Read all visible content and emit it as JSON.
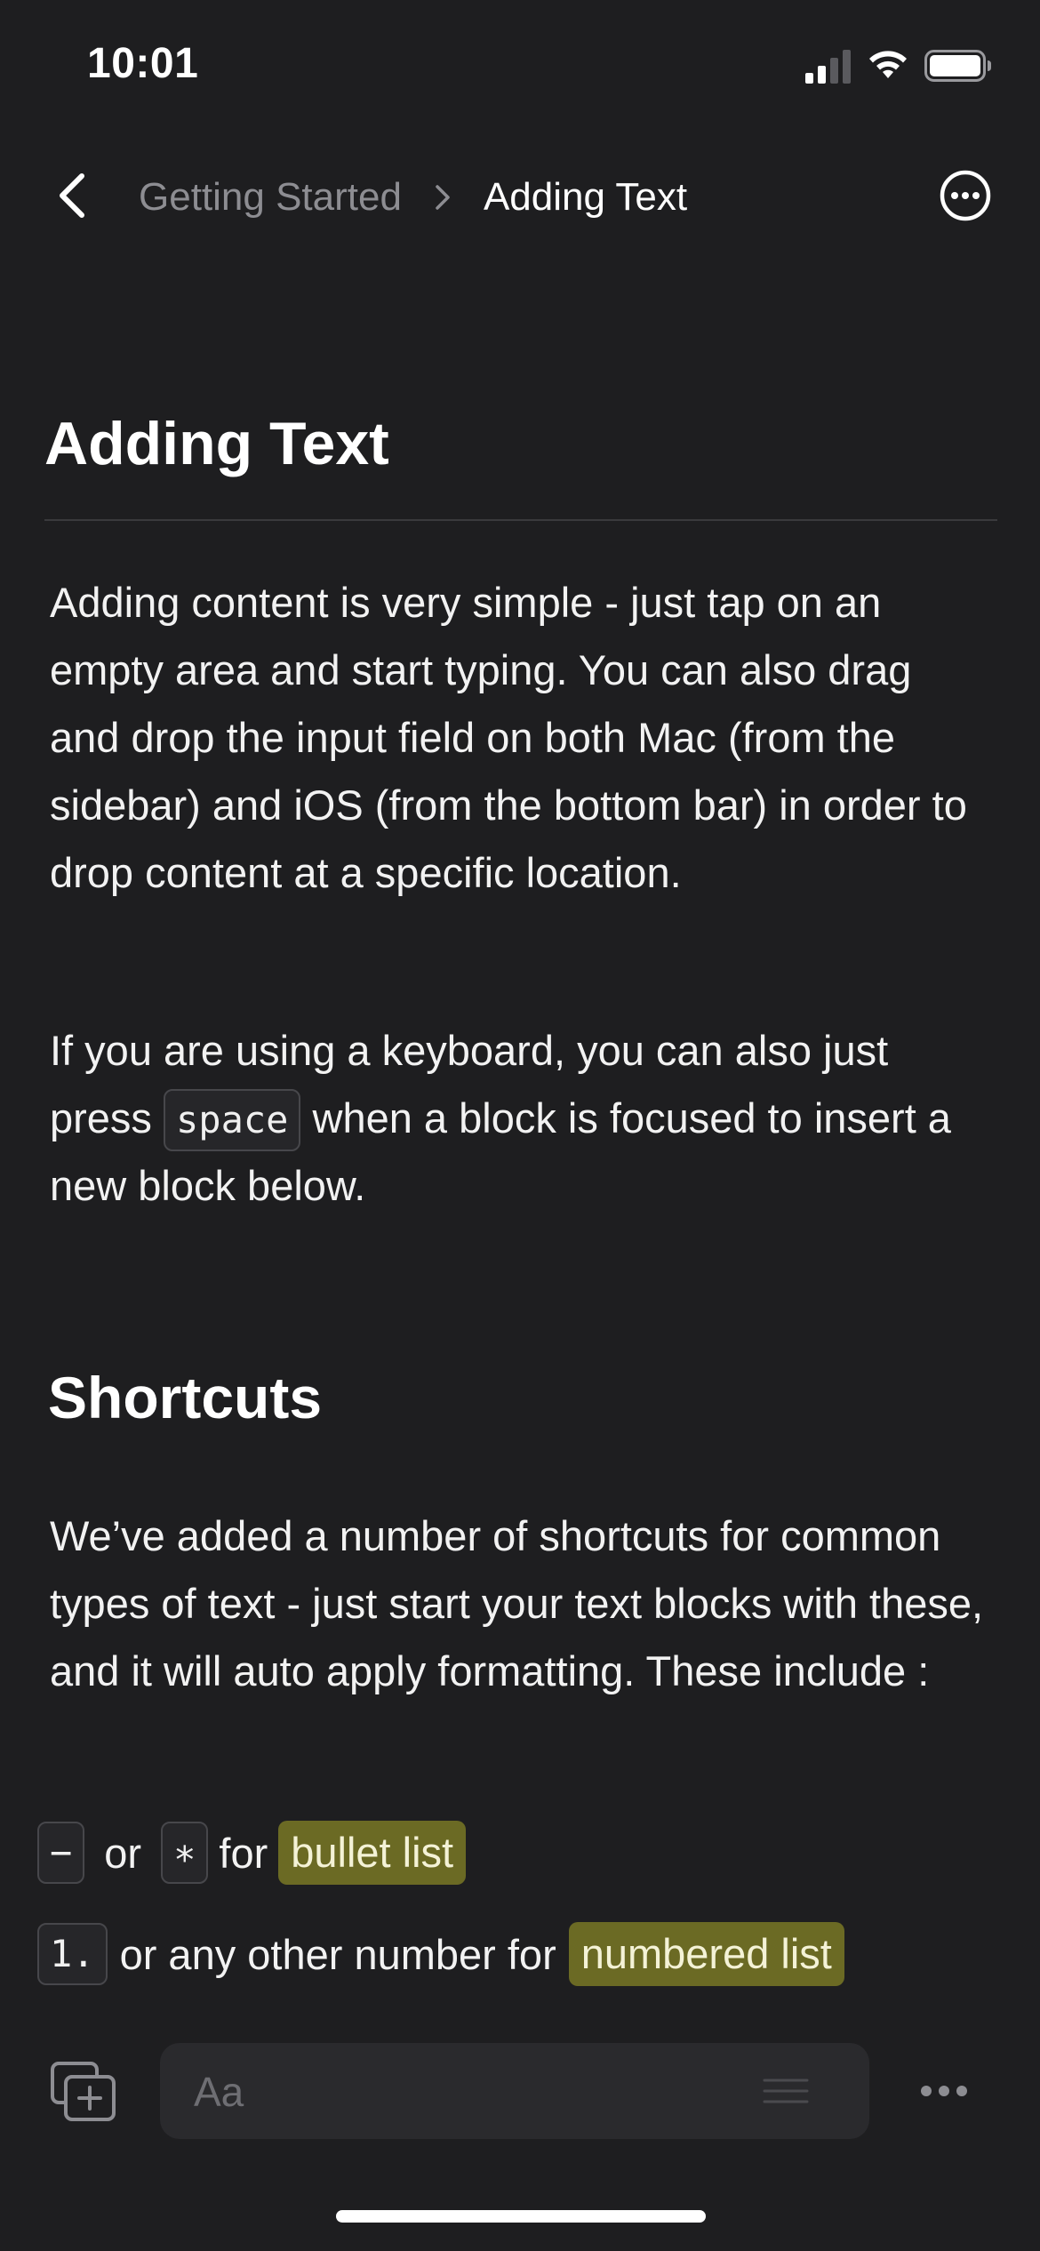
{
  "status_bar": {
    "time": "10:01",
    "icons": [
      "signal-icon",
      "wifi-icon",
      "battery-icon"
    ]
  },
  "nav": {
    "back_icon": "chevron-left-icon",
    "breadcrumb_parent": "Getting Started",
    "breadcrumb_separator_icon": "chevron-right-icon",
    "breadcrumb_current": "Adding Text",
    "more_icon": "ellipsis-circle-icon"
  },
  "page": {
    "title": "Adding Text",
    "para1": "Adding content is very simple - just tap on an empty area and start typing. You can also drag and drop the input field on both Mac (from the sidebar) and iOS (from the bottom bar) in order to drop content at a specific location.",
    "para2_before": "If you are using a keyboard, you can also just press ",
    "para2_code": "space",
    "para2_after": " when a block is focused to insert a new block below.",
    "section_heading": "Shortcuts",
    "para3": "We’ve added a number of shortcuts for common types of text - just start your text blocks with these, and it will auto apply formatting. These include :",
    "shortcuts": [
      {
        "code_a": "−",
        "or_text": "or",
        "code_b": "∗",
        "for_text": "for",
        "highlight": "bullet list"
      },
      {
        "code": "1.",
        "text": "or any other number for",
        "highlight": "numbered list"
      }
    ]
  },
  "toolbar": {
    "add_icon": "add-block-icon",
    "input_placeholder": "Aa",
    "drag_icon": "drag-handle-icon",
    "more_icon": "ellipsis-icon"
  },
  "colors": {
    "background": "#1e1e20",
    "highlight": "#6b6a24",
    "muted_text": "#8d8d92"
  }
}
